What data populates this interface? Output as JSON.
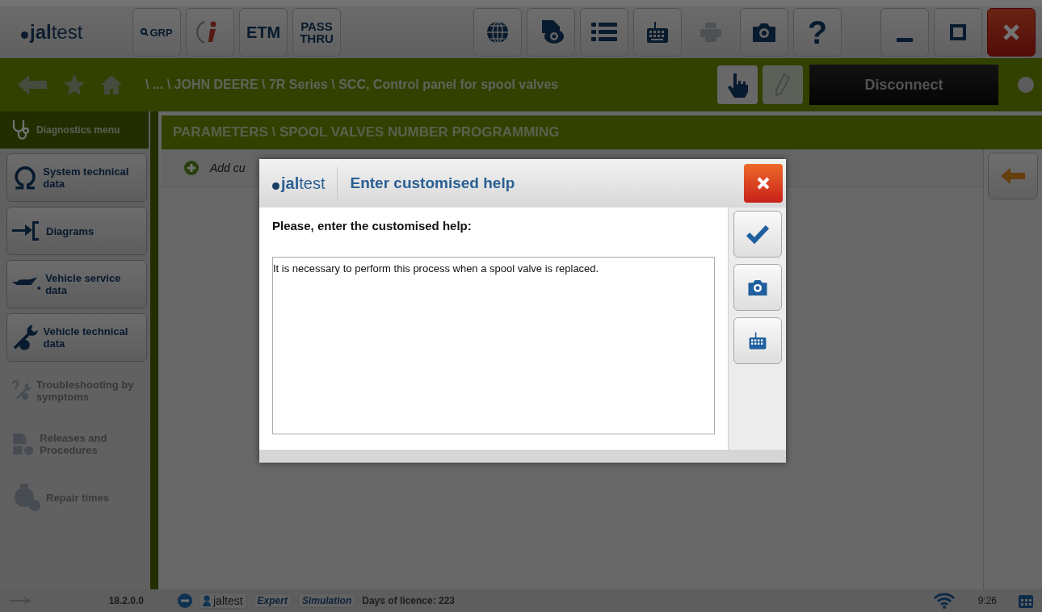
{
  "toolbar": {
    "logo": "**jal**test",
    "left": [
      {
        "kind": "grp",
        "label": "GRP"
      },
      {
        "kind": "info"
      },
      {
        "kind": "text",
        "label": "ETM"
      },
      {
        "kind": "stack",
        "label": "PASS",
        "label2": "THRU"
      }
    ],
    "right": [
      {
        "kind": "globe",
        "disabled": false
      },
      {
        "kind": "document-eye",
        "disabled": false
      },
      {
        "kind": "list",
        "disabled": false
      },
      {
        "kind": "keyboard",
        "disabled": false
      },
      {
        "kind": "printer",
        "disabled": true
      },
      {
        "kind": "camera",
        "disabled": false
      },
      {
        "kind": "help",
        "label": "?",
        "disabled": false
      }
    ],
    "window": [
      {
        "kind": "minimize"
      },
      {
        "kind": "maximize"
      },
      {
        "kind": "close"
      }
    ]
  },
  "breadcrumb": {
    "path": "\\ ... \\ JOHN DEERE \\ 7R Series \\ SCC, Control panel for spool valves",
    "tools": [
      {
        "kind": "hand",
        "disabled": false
      },
      {
        "kind": "pencil",
        "disabled": true
      }
    ],
    "connect_button": "Disconnect"
  },
  "sidebar": {
    "items": [
      {
        "kind": "stethoscope",
        "label": "Diagnostics menu",
        "selected": true,
        "disabled": false
      },
      {
        "kind": "omega",
        "label": "System technical data",
        "selected": false,
        "disabled": false
      },
      {
        "kind": "diagram",
        "label": "Diagrams",
        "selected": false,
        "disabled": false
      },
      {
        "kind": "oilcan",
        "label": "Vehicle service data",
        "selected": false,
        "disabled": false
      },
      {
        "kind": "wrench",
        "label": "Vehicle technical data",
        "selected": false,
        "disabled": false
      },
      {
        "kind": "question-wrench",
        "label": "Troubleshooting by symptoms",
        "selected": false,
        "disabled": true
      },
      {
        "kind": "document",
        "label": "Releases and Procedures",
        "selected": false,
        "disabled": true
      },
      {
        "kind": "clock",
        "label": "Repair times",
        "selected": false,
        "disabled": true
      }
    ]
  },
  "page": {
    "heading": "PARAMETERS \\ SPOOL VALVES NUMBER PROGRAMMING",
    "add_action": "Add cu"
  },
  "dialog": {
    "logo": "**jal**test",
    "title": "Enter customised help",
    "prompt": "Please, enter the customised help:",
    "value": "It is necessary to perform this process when a spool valve is replaced.",
    "side_buttons": [
      {
        "kind": "check"
      },
      {
        "kind": "camera"
      },
      {
        "kind": "keyboard"
      }
    ]
  },
  "status_bar": {
    "version": "18.2.0.0",
    "user": "jaltest",
    "level": "Expert",
    "mode": "Simulation",
    "licence": "Days of licence: 223",
    "time": "9:26"
  }
}
